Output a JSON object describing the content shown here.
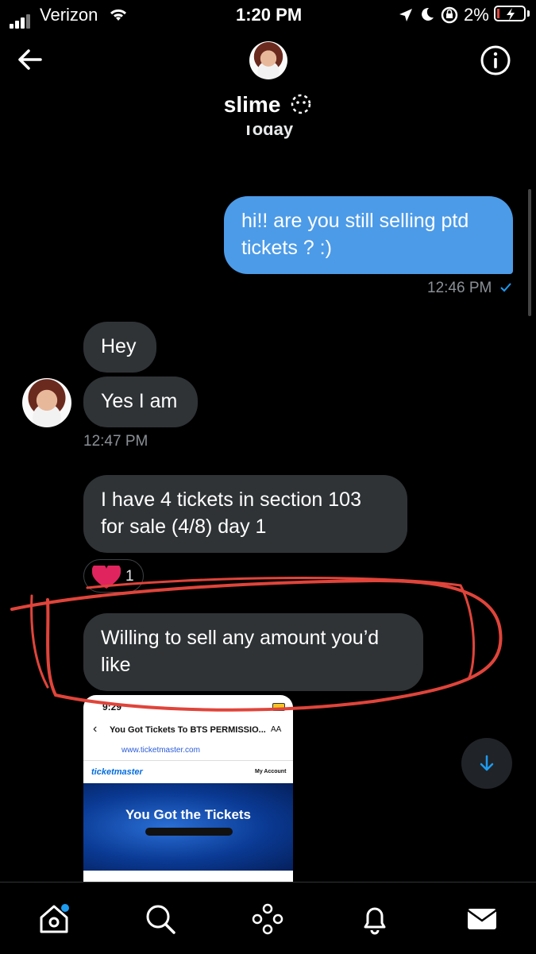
{
  "status": {
    "carrier": "Verizon",
    "time": "1:20 PM",
    "battery": "2%"
  },
  "header": {
    "name": "slime",
    "name_emoji": "🫢",
    "back_label": "Back",
    "info_label": "Conversation info"
  },
  "day_label": "Today",
  "messages": [
    {
      "from": "me",
      "text": "hi!! are you still selling ptd tickets ? :)",
      "time": "12:46 PM"
    },
    {
      "from": "them",
      "text": "Hey"
    },
    {
      "from": "them",
      "text": "Yes I am",
      "time": "12:47 PM"
    },
    {
      "from": "them",
      "text": "I have 4 tickets in section 103 for sale (4/8) day 1",
      "reaction_count": "1"
    },
    {
      "from": "them",
      "text": "Willing to sell any amount you’d like"
    }
  ],
  "attachment": {
    "time": "9:29",
    "subject": "You Got Tickets To BTS PERMISSIO...",
    "aa": "AA",
    "sender": "www.ticketmaster.com",
    "brand": "ticketmaster",
    "account": "My Account",
    "banner": "You Got the Tickets"
  },
  "colors": {
    "accent": "#1d9bf0",
    "bubble_me": "#4c9be8",
    "bubble_them": "#2f3336",
    "annotation": "#e0443a",
    "heart": "#f91880"
  },
  "tabs": [
    "home-icon",
    "search-icon",
    "spaces-icon",
    "notifications-icon",
    "messages-icon"
  ]
}
